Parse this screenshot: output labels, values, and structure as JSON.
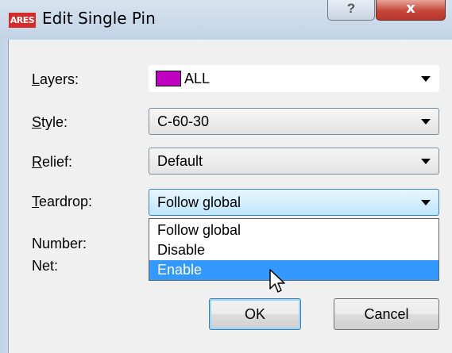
{
  "window": {
    "title": "Edit Single Pin",
    "app_icon_text": "ARES",
    "help_label": "?",
    "close_label": "x"
  },
  "form": {
    "layers": {
      "label_u": "L",
      "label_rest": "ayers:",
      "value": "ALL",
      "swatch_color": "#c000c0"
    },
    "style": {
      "label_u": "S",
      "label_rest": "tyle:",
      "value": "C-60-30"
    },
    "relief": {
      "label_u": "R",
      "label_rest": "elief:",
      "value": "Default"
    },
    "teardrop": {
      "label_u": "T",
      "label_rest": "eardrop:",
      "value": "Follow global"
    },
    "number_label": "Number:",
    "net_label": "Net:"
  },
  "dropdown": {
    "options": [
      "Follow global",
      "Disable",
      "Enable"
    ],
    "selected": "Enable"
  },
  "buttons": {
    "ok": "OK",
    "cancel": "Cancel"
  },
  "colors": {
    "highlight": "#3399ff",
    "close_button": "#c6463a"
  }
}
